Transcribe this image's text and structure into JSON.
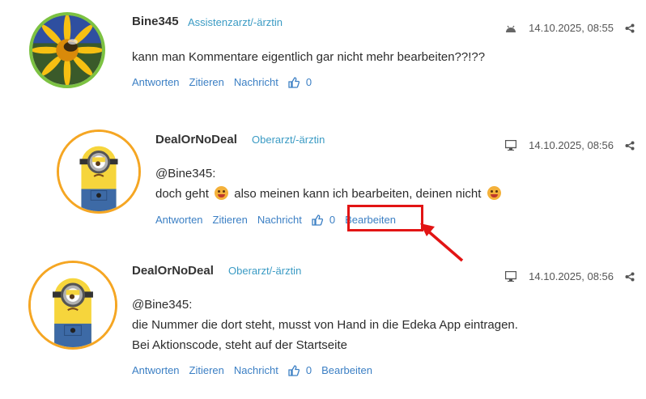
{
  "posts": [
    {
      "username": "Bine345",
      "role": "Assistenzarzt/-ärztin",
      "device_icon": "android-icon",
      "timestamp": "14.10.2025, 08:55",
      "lines": [
        "kann man Kommentare eigentlich gar nicht mehr bearbeiten??!??"
      ],
      "actions": {
        "reply": "Antworten",
        "quote": "Zitieren",
        "message": "Nachricht",
        "likes": "0"
      }
    },
    {
      "username": "DealOrNoDeal",
      "role": "Oberarzt/-ärztin",
      "device_icon": "desktop-icon",
      "timestamp": "14.10.2025, 08:56",
      "lines": [
        "@Bine345:",
        "doch geht",
        "also meinen kann ich bearbeiten, deinen nicht"
      ],
      "actions": {
        "reply": "Antworten",
        "quote": "Zitieren",
        "message": "Nachricht",
        "likes": "0",
        "edit": "Bearbeiten"
      }
    },
    {
      "username": "DealOrNoDeal",
      "role": "Oberarzt/-ärztin",
      "device_icon": "desktop-icon",
      "timestamp": "14.10.2025, 08:56",
      "lines": [
        "@Bine345:",
        "die Nummer die dort steht, musst von Hand in die Edeka App eintragen.",
        "Bei Aktionscode, steht auf der Startseite"
      ],
      "actions": {
        "reply": "Antworten",
        "quote": "Zitieren",
        "message": "Nachricht",
        "likes": "0",
        "edit": "Bearbeiten"
      }
    }
  ],
  "colors": {
    "link": "#3b7fc4",
    "role": "#3b9bc4",
    "highlight": "#e21414",
    "avatar_ring_green": "#7cc242",
    "avatar_ring_orange": "#f5a623"
  }
}
